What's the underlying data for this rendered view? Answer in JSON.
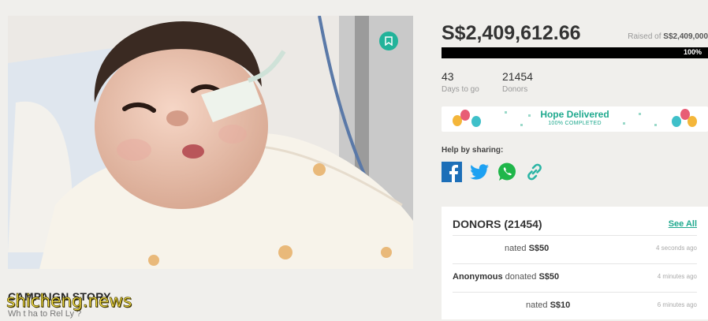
{
  "campaign": {
    "amount": "S$2,409,612.66",
    "raised_prefix": "Raised of ",
    "raised_target": "S$2,409,000",
    "progress_percent": 100,
    "progress_label": "100%",
    "days": "43",
    "days_label": "Days to go",
    "donors_count": "21454",
    "donors_label": "Donors"
  },
  "hope": {
    "title": "Hope Delivered",
    "subtitle": "100% COMPLETED"
  },
  "share": {
    "label": "Help by sharing:",
    "icons": [
      "facebook-icon",
      "twitter-icon",
      "whatsapp-icon",
      "link-icon"
    ]
  },
  "donors": {
    "title": "DONORS (21454)",
    "see_all": "See All",
    "rows": [
      {
        "name": "",
        "text": "nated",
        "amount": "S$50",
        "time": "4 seconds ago"
      },
      {
        "name": "Anonymous",
        "text": " donated ",
        "amount": "S$50",
        "time": "4 minutes ago"
      },
      {
        "name": "",
        "text": "nated ",
        "amount": "S$10",
        "time": "6 minutes ago"
      }
    ]
  },
  "story": {
    "title": "CAMPAIGN STORY",
    "subtitle": "Wh t ha      to Rel  Ly  ?"
  },
  "watermark": "shicheng.news",
  "colors": {
    "accent": "#1fa98e",
    "progress": "#000000",
    "watermark": "#ffe84a"
  }
}
